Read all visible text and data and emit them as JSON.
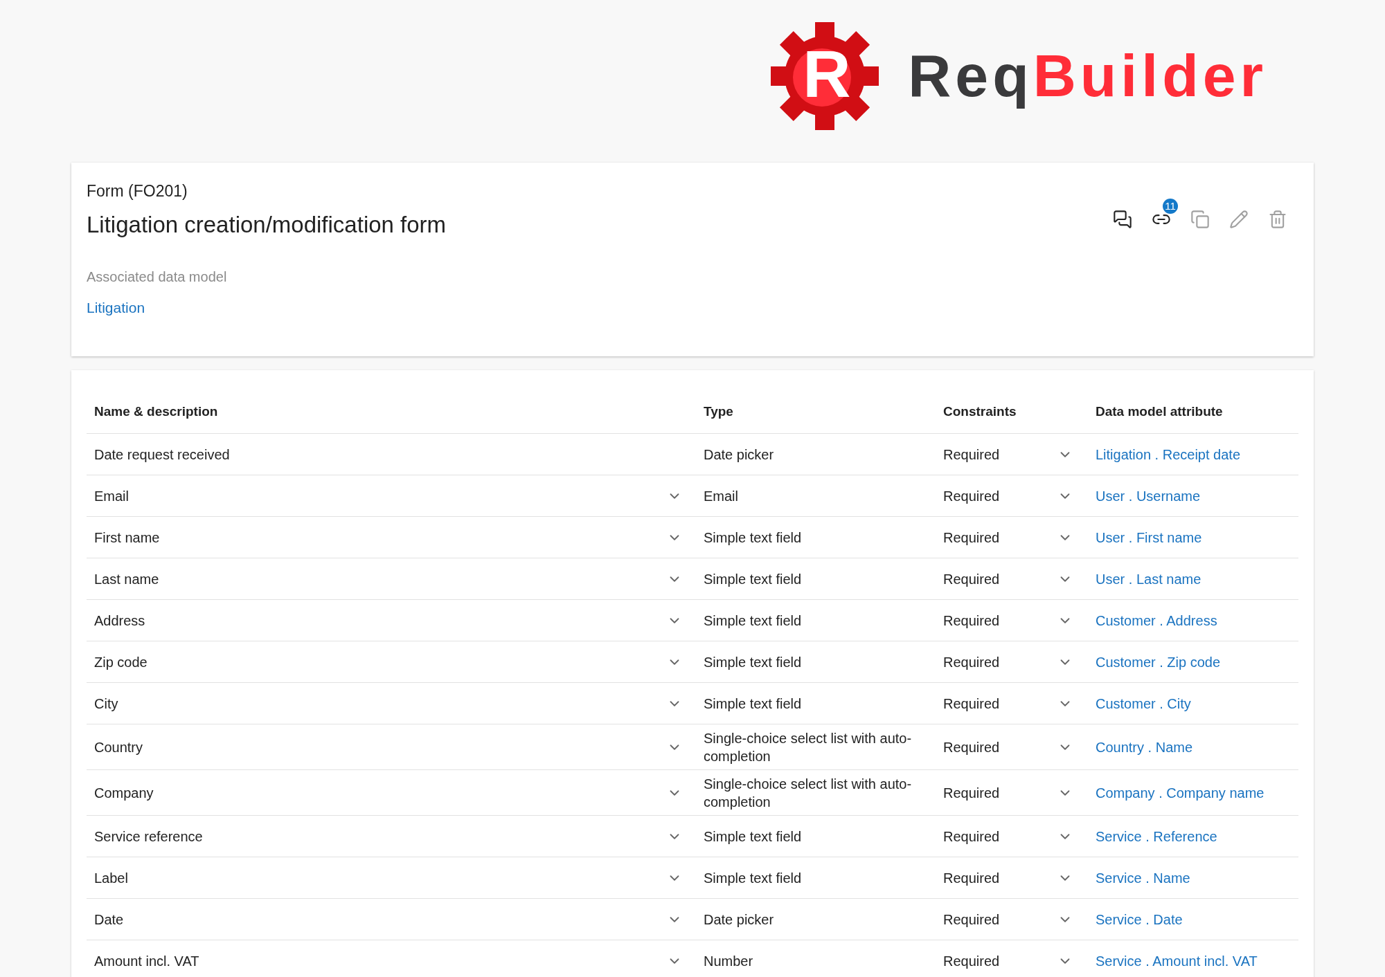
{
  "logo": {
    "mark": "R",
    "word_dark": "Req",
    "word_red": "Builder"
  },
  "header": {
    "kind_label": "Form (FO201)",
    "title": "Litigation creation/modification form",
    "data_model_label": "Associated data model",
    "data_model_link": "Litigation"
  },
  "toolbar": [
    {
      "kind": "comments",
      "disabled": false
    },
    {
      "kind": "links",
      "disabled": false,
      "badge": "11"
    },
    {
      "kind": "copy",
      "disabled": true
    },
    {
      "kind": "edit",
      "disabled": true
    },
    {
      "kind": "delete",
      "disabled": true
    }
  ],
  "table": {
    "columns": [
      "Name & description",
      "Type",
      "Constraints",
      "Data model attribute"
    ],
    "rows": [
      {
        "name": "Date request received",
        "name_expandable": false,
        "type": "Date picker",
        "constraints": "Required",
        "attribute": "Litigation . Receipt date"
      },
      {
        "name": "Email",
        "name_expandable": true,
        "type": "Email",
        "constraints": "Required",
        "attribute": "User . Username"
      },
      {
        "name": "First name",
        "name_expandable": true,
        "type": "Simple text field",
        "constraints": "Required",
        "attribute": "User . First name"
      },
      {
        "name": "Last name",
        "name_expandable": true,
        "type": "Simple text field",
        "constraints": "Required",
        "attribute": "User . Last name"
      },
      {
        "name": "Address",
        "name_expandable": true,
        "type": "Simple text field",
        "constraints": "Required",
        "attribute": "Customer . Address"
      },
      {
        "name": "Zip code",
        "name_expandable": true,
        "type": "Simple text field",
        "constraints": "Required",
        "attribute": "Customer . Zip code"
      },
      {
        "name": "City",
        "name_expandable": true,
        "type": "Simple text field",
        "constraints": "Required",
        "attribute": "Customer . City"
      },
      {
        "name": "Country",
        "name_expandable": true,
        "type": "Single-choice select list with auto-completion",
        "constraints": "Required",
        "attribute": "Country . Name"
      },
      {
        "name": "Company",
        "name_expandable": true,
        "type": "Single-choice select list with auto-completion",
        "constraints": "Required",
        "attribute": "Company . Company name"
      },
      {
        "name": "Service reference",
        "name_expandable": true,
        "type": "Simple text field",
        "constraints": "Required",
        "attribute": "Service . Reference"
      },
      {
        "name": "Label",
        "name_expandable": true,
        "type": "Simple text field",
        "constraints": "Required",
        "attribute": "Service . Name"
      },
      {
        "name": "Date",
        "name_expandable": true,
        "type": "Date picker",
        "constraints": "Required",
        "attribute": "Service . Date"
      },
      {
        "name": "Amount incl. VAT",
        "name_expandable": true,
        "type": "Number",
        "constraints": "Required",
        "attribute": "Service . Amount incl. VAT"
      }
    ]
  }
}
